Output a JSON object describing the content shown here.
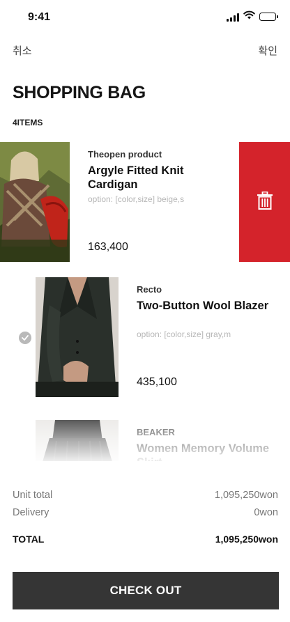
{
  "status_bar": {
    "time": "9:41",
    "icons": [
      "signal-icon",
      "wifi-icon",
      "battery-icon"
    ]
  },
  "nav": {
    "cancel_label": "취소",
    "confirm_label": "확인"
  },
  "header": {
    "title": "SHOPPING BAG",
    "item_count": "4ITEMS"
  },
  "items": [
    {
      "brand": "Theopen product",
      "name": "Argyle Fitted Knit Cardigan",
      "option": "option: [color,size] beige,s",
      "price": "163,400",
      "swipe_action_icon": "trash-icon"
    },
    {
      "brand": "Recto",
      "name": "Two-Button Wool Blazer",
      "option": "option: [color,size] gray,m",
      "price": "435,100",
      "select_icon": "check-circle-icon"
    },
    {
      "brand": "BEAKER",
      "name": "Women Memory Volume Skirt"
    }
  ],
  "summary": {
    "unit_total_label": "Unit total",
    "unit_total_value": "1,095,250won",
    "delivery_label": "Delivery",
    "delivery_value": "0won",
    "total_label": "TOTAL",
    "total_value": "1,095,250won"
  },
  "checkout_label": "CHECK OUT",
  "colors": {
    "delete": "#d4232b",
    "checkout_button": "#353535",
    "option_text": "#b6b6b6"
  }
}
